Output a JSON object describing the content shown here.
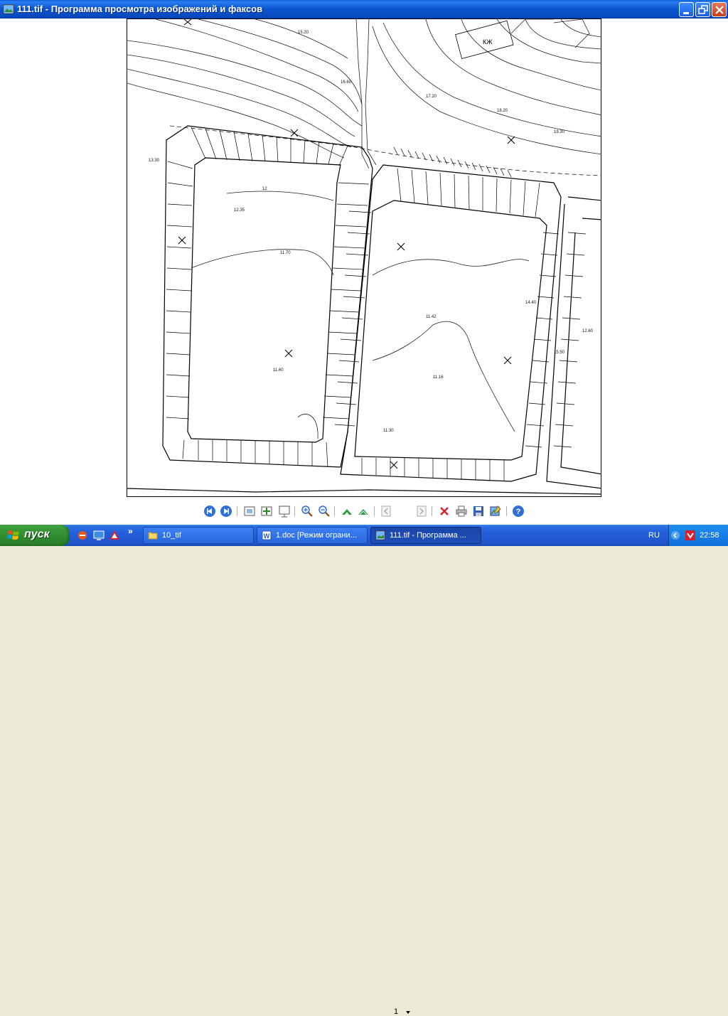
{
  "window": {
    "title": "111.tif - Программа просмотра изображений и факсов",
    "controls": [
      "minimize",
      "restore",
      "close"
    ]
  },
  "map": {
    "building_label": "КЖ",
    "labels": [
      "15.20",
      "16.60",
      "17.20",
      "18.20",
      "19.30",
      "12",
      "11.70",
      "11.60",
      "12.35",
      "11.42",
      "11.16",
      "13.30",
      "14.40",
      "15.50",
      "12.60",
      "11.30"
    ]
  },
  "toolbar": {
    "buttons": [
      "prev-image-icon",
      "next-image-icon",
      "best-fit-icon",
      "actual-size-icon",
      "slideshow-icon",
      "zoom-in-icon",
      "zoom-out-icon",
      "rotate-cw-icon",
      "rotate-ccw-icon",
      "prev-page-icon",
      "next-page-icon",
      "delete-icon",
      "print-icon",
      "save-icon",
      "open-editor-icon",
      "help-icon"
    ],
    "page_number": "1"
  },
  "taskbar": {
    "start_label": "пуск",
    "tasks": [
      {
        "label": "10_tif",
        "icon": "folder-icon"
      },
      {
        "label": "1.doc [Режим ограни...",
        "icon": "word-icon"
      },
      {
        "label": "111.tif - Программа ...",
        "icon": "image-viewer-icon"
      }
    ],
    "quick_launch_more": "»",
    "language": "RU",
    "clock": "22:58"
  }
}
